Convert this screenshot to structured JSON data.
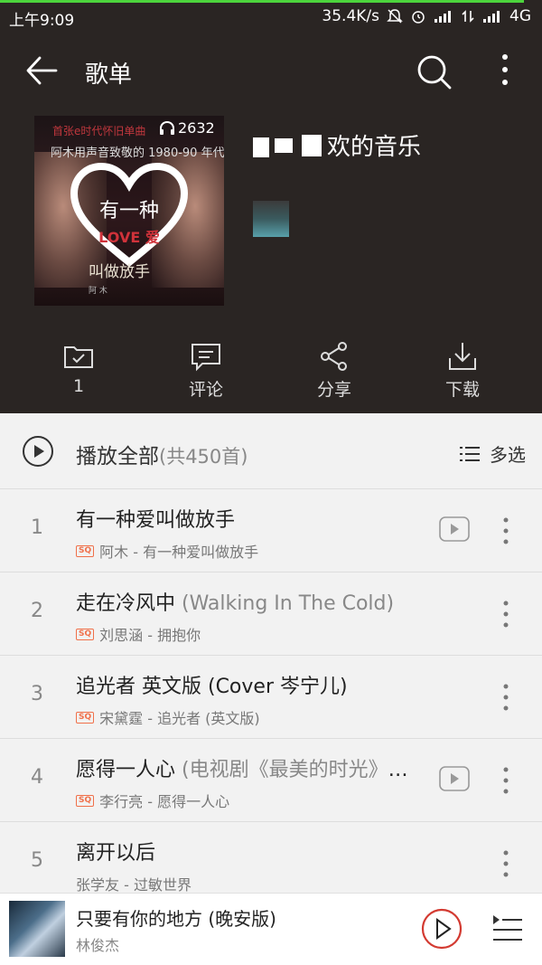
{
  "status_bar": {
    "time": "上午9:09",
    "speed": "35.4K/s",
    "network": "4G"
  },
  "header": {
    "title": "歌单"
  },
  "playlist": {
    "name_visible": "欢的音乐",
    "play_count": "2632",
    "cover": {
      "line1": "首张e时代怀旧单曲",
      "line2": "阿木用声音致敬的 1980-90 年代",
      "heart_text": "有一种",
      "love_text": "LOVE 爱",
      "subtitle": "叫做放手",
      "artist_mark": "阿 木"
    }
  },
  "actions": [
    {
      "label": "1",
      "icon": "folder-check-icon"
    },
    {
      "label": "评论",
      "icon": "comment-icon"
    },
    {
      "label": "分享",
      "icon": "share-icon"
    },
    {
      "label": "下载",
      "icon": "download-icon"
    }
  ],
  "list_header": {
    "play_all": "播放全部",
    "count": "(共450首)",
    "multi_select": "多选"
  },
  "songs": [
    {
      "num": "1",
      "title": "有一种爱叫做放手",
      "extra": "",
      "sq": true,
      "subtitle": "阿木 - 有一种爱叫做放手",
      "mv": true
    },
    {
      "num": "2",
      "title": "走在冷风中 ",
      "extra": "(Walking In The Cold)",
      "sq": true,
      "subtitle": "刘思涵 - 拥抱你",
      "mv": false
    },
    {
      "num": "3",
      "title": "追光者 英文版 (Cover 岑宁儿)",
      "extra": "",
      "sq": true,
      "subtitle": "宋黛霆 - 追光者 (英文版)",
      "mv": false
    },
    {
      "num": "4",
      "title": "愿得一人心 ",
      "extra": "(电视剧《最美的时光》插曲)",
      "sq": true,
      "subtitle": "李行亮 - 愿得一人心",
      "mv": true
    },
    {
      "num": "5",
      "title": "离开以后",
      "extra": "",
      "sq": false,
      "subtitle": "张学友 - 过敏世界",
      "mv": false
    }
  ],
  "sq_badge": "SQ",
  "now_playing": {
    "title": "只要有你的地方 (晚安版)",
    "artist": "林俊杰"
  },
  "colors": {
    "dark_bg": "#2a2523",
    "list_bg": "#f2f2f2",
    "accent_red": "#d33a31",
    "sq_orange": "#f0704a",
    "green_bar": "#4cd43c"
  }
}
